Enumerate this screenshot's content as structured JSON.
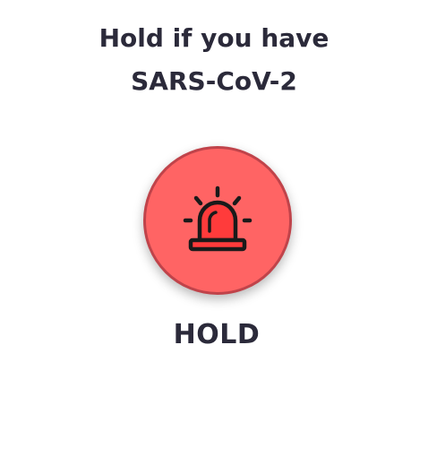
{
  "title": {
    "line1": "Hold if you have",
    "line2": "SARS-CoV-2"
  },
  "button": {
    "icon": "siren-alarm-icon",
    "label": "HOLD",
    "fill_color": "#ff6464",
    "border_color": "#c0434a"
  },
  "colors": {
    "text": "#2b2a3a",
    "background": "#ffffff"
  }
}
